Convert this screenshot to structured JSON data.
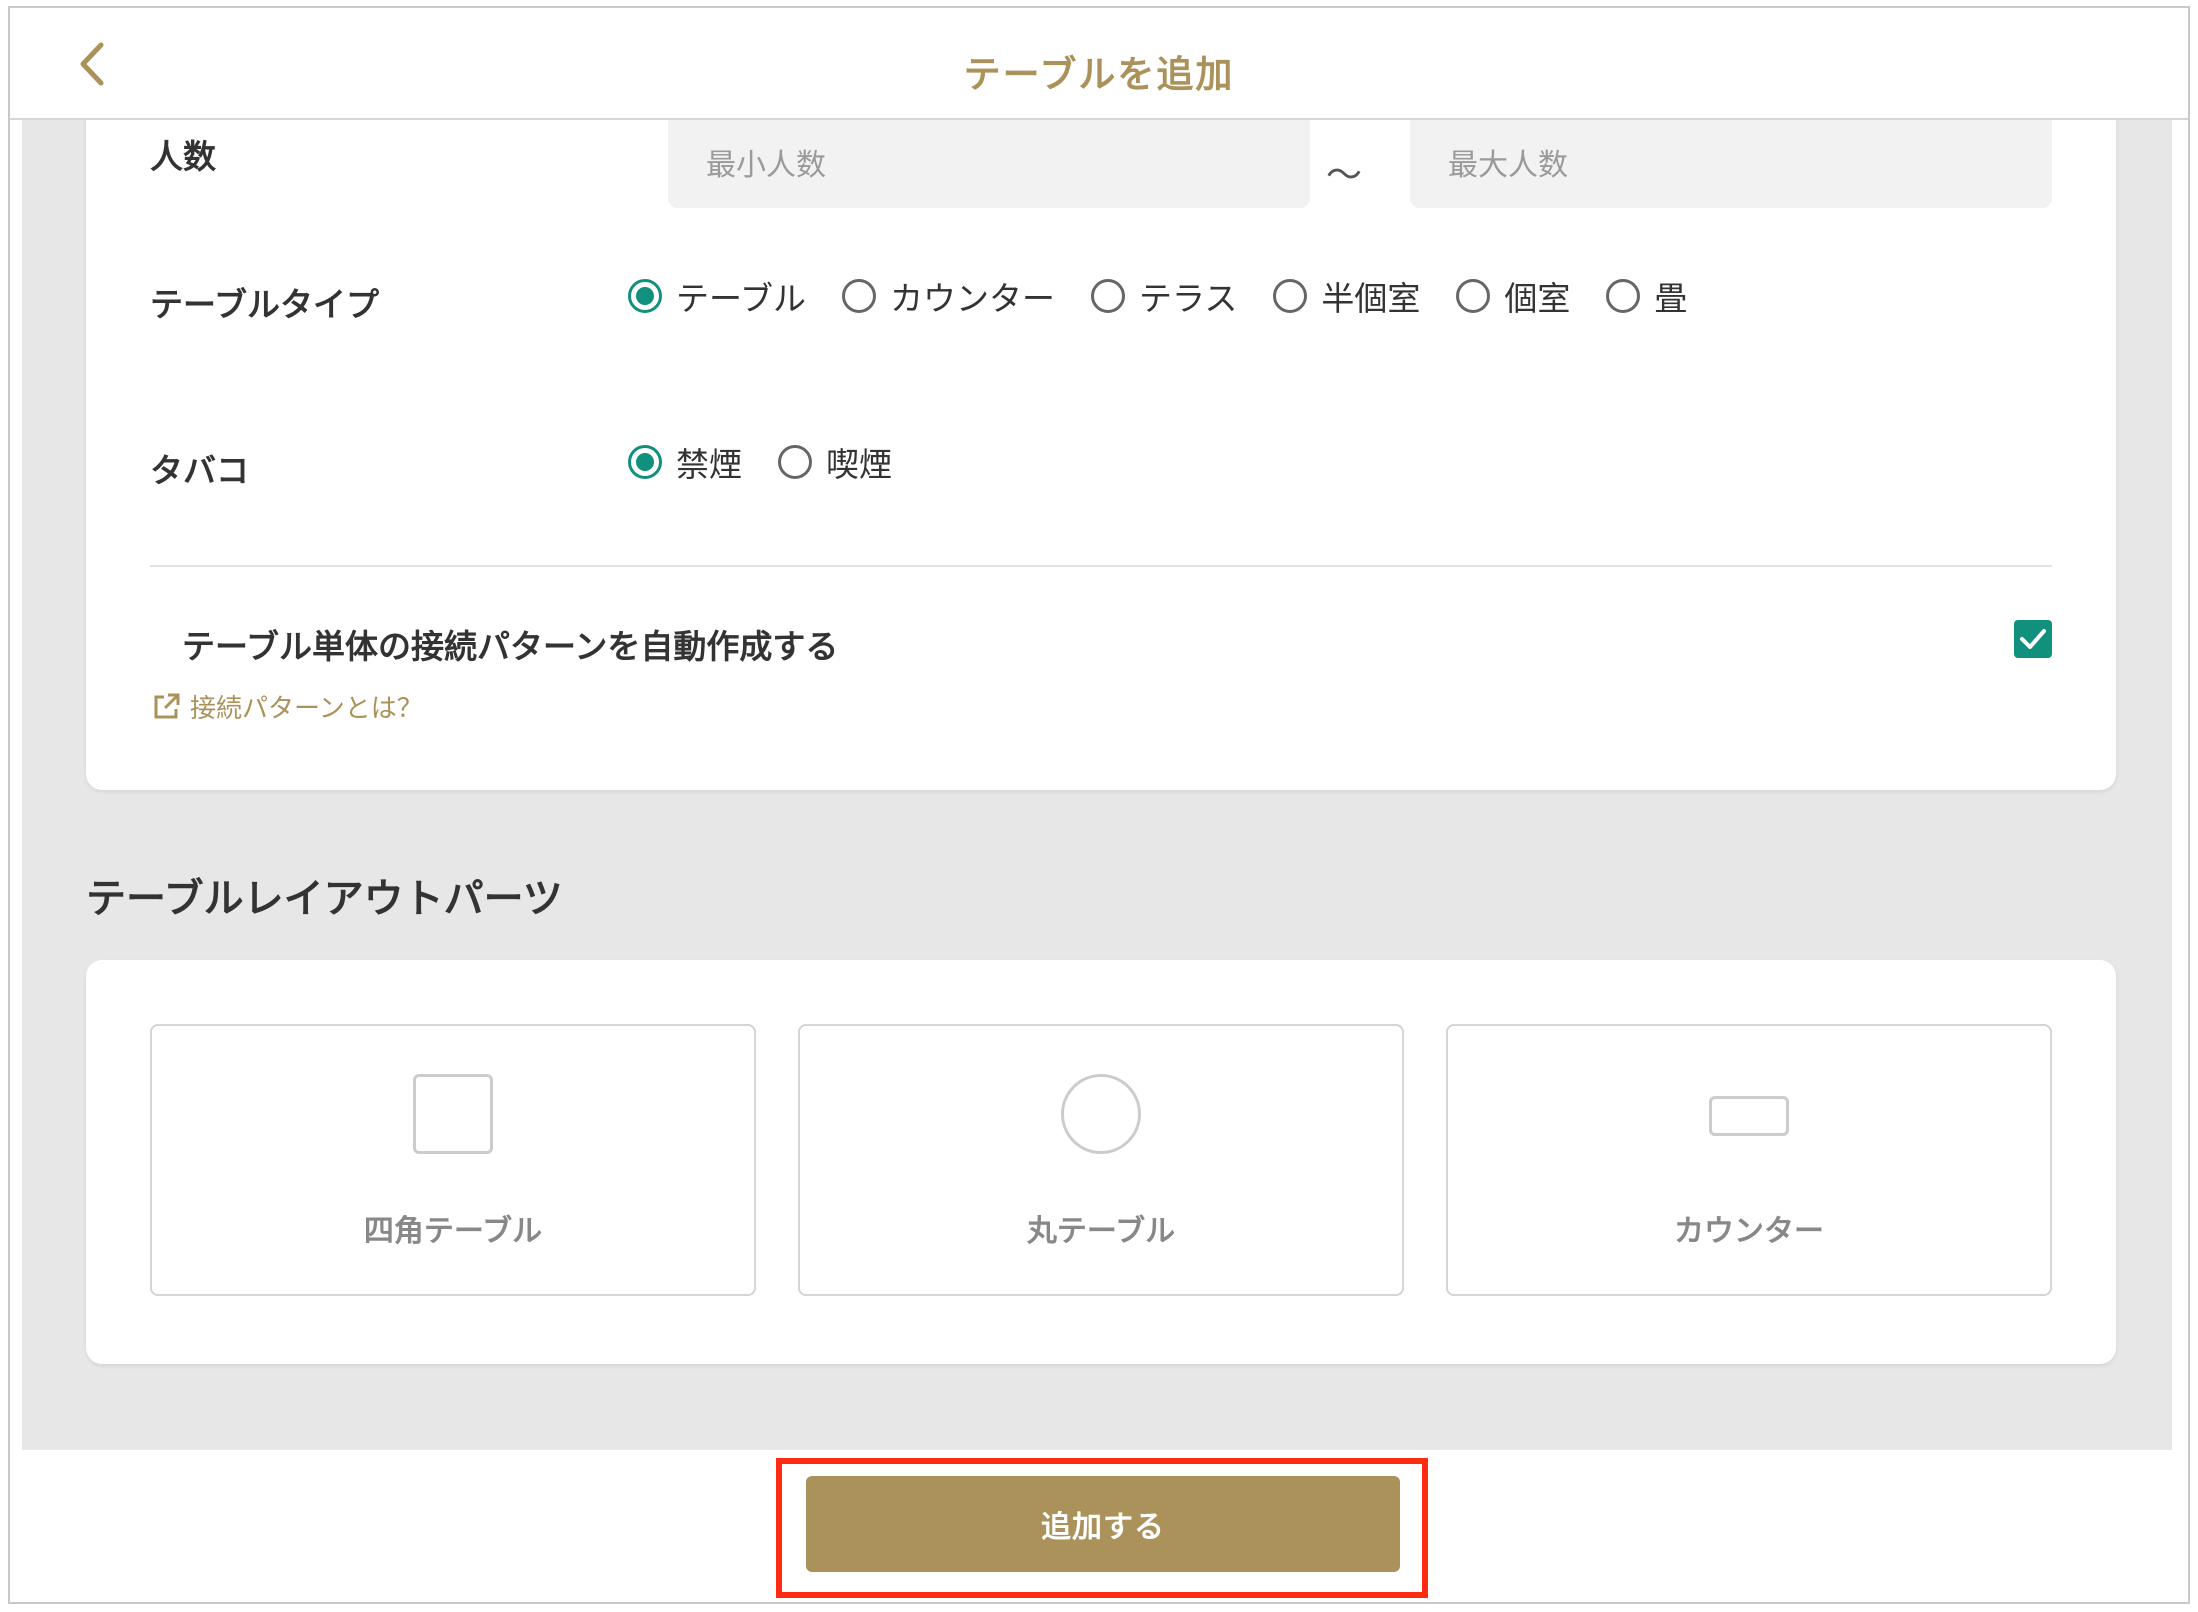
{
  "header": {
    "title": "テーブルを追加"
  },
  "form": {
    "capacity": {
      "label": "人数",
      "min_placeholder": "最小人数",
      "separator": "〜",
      "max_placeholder": "最大人数"
    },
    "table_type": {
      "label": "テーブルタイプ",
      "options": [
        "テーブル",
        "カウンター",
        "テラス",
        "半個室",
        "個室",
        "畳"
      ],
      "selected": "テーブル"
    },
    "tobacco": {
      "label": "タバコ",
      "options": [
        "禁煙",
        "喫煙"
      ],
      "selected": "禁煙"
    },
    "auto_pattern": {
      "label": "テーブル単体の接続パターンを自動作成する",
      "checked": true,
      "help_link": "接続パターンとは？"
    }
  },
  "layout_parts": {
    "title": "テーブルレイアウトパーツ",
    "items": [
      {
        "label": "四角テーブル",
        "icon": "square-table-icon"
      },
      {
        "label": "丸テーブル",
        "icon": "round-table-icon"
      },
      {
        "label": "カウンター",
        "icon": "counter-table-icon"
      }
    ]
  },
  "footer": {
    "submit_label": "追加する"
  },
  "colors": {
    "accent_gold": "#ab925a",
    "accent_teal": "#12907e",
    "highlight_red": "#ff2a12",
    "background_gray": "#e7e7e7"
  }
}
